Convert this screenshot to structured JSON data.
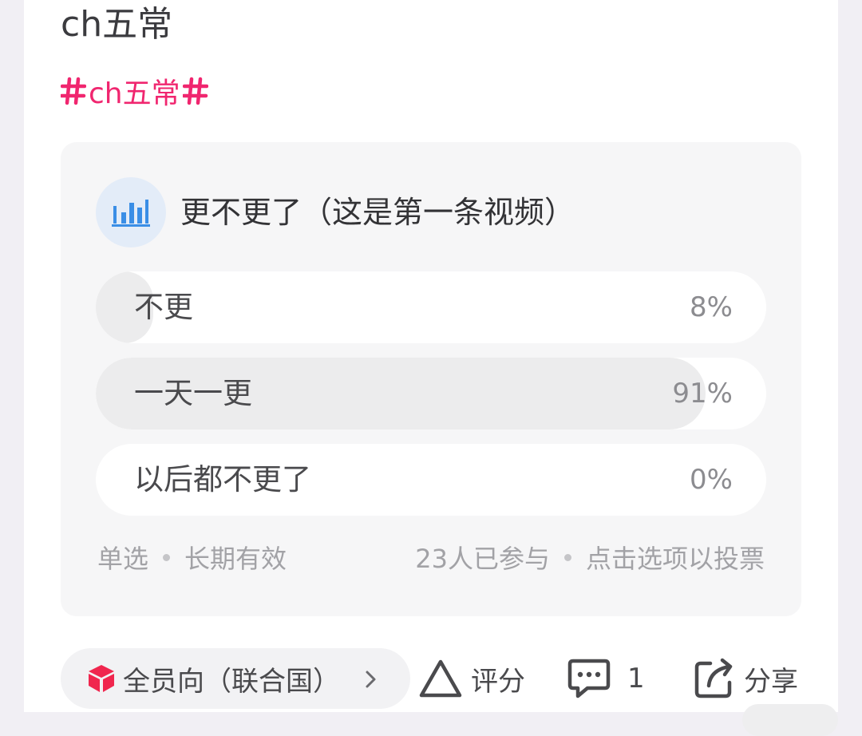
{
  "post": {
    "title": "ch五常",
    "hashtag": "ch五常"
  },
  "poll": {
    "icon": "bar-chart-icon",
    "question": "更不更了（这是第一条视频）",
    "options": [
      {
        "label": "不更",
        "percent_text": "8%",
        "percent": 8
      },
      {
        "label": "一天一更",
        "percent_text": "91%",
        "percent": 91
      },
      {
        "label": "以后都不更了",
        "percent_text": "0%",
        "percent": 0
      }
    ],
    "footer": {
      "type": "单选",
      "duration": "长期有效",
      "participants": "23人已参与",
      "hint": "点击选项以投票"
    }
  },
  "actions": {
    "channel": "全员向（联合国）",
    "rate": "评分",
    "comment_count": "1",
    "share": "分享"
  },
  "colors": {
    "hashtag": "#f0266f",
    "poll_icon": "#3a8ee6",
    "option_fill": "#ececed",
    "channel_icon": "#f0264e"
  }
}
